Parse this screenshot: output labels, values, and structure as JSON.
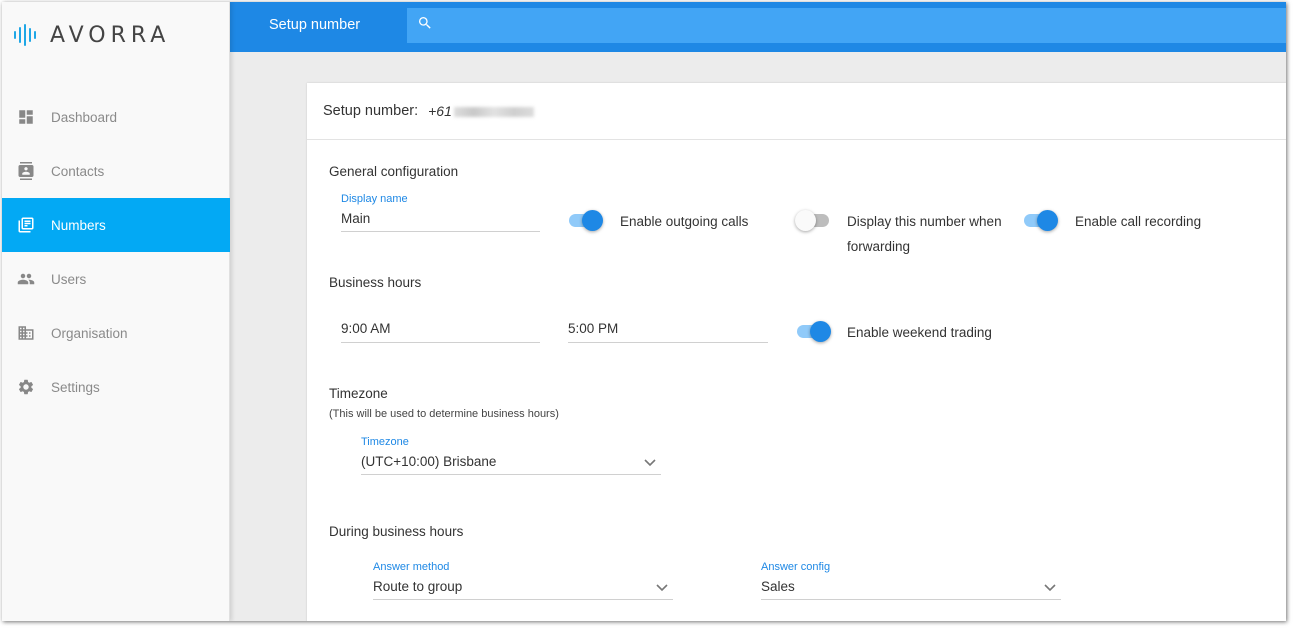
{
  "app": {
    "name": "AVORRA"
  },
  "sidebar": {
    "items": [
      {
        "label": "Dashboard",
        "icon": "dashboard-icon"
      },
      {
        "label": "Contacts",
        "icon": "contacts-icon"
      },
      {
        "label": "Numbers",
        "icon": "numbers-icon",
        "active": true
      },
      {
        "label": "Users",
        "icon": "users-icon"
      },
      {
        "label": "Organisation",
        "icon": "organisation-icon"
      },
      {
        "label": "Settings",
        "icon": "settings-icon"
      }
    ]
  },
  "topbar": {
    "title": "Setup number",
    "search_placeholder": ""
  },
  "card": {
    "title": "Setup number:",
    "number": "+61"
  },
  "general": {
    "heading": "General configuration",
    "display_name_label": "Display name",
    "display_name_value": "Main",
    "outgoing_label": "Enable outgoing calls",
    "outgoing_on": true,
    "forwarding_label": "Display this number when forwarding",
    "forwarding_on": false,
    "recording_label": "Enable call recording",
    "recording_on": true
  },
  "business_hours": {
    "heading": "Business hours",
    "start": "9:00 AM",
    "end": "5:00 PM",
    "weekend_label": "Enable weekend trading",
    "weekend_on": true
  },
  "timezone": {
    "heading": "Timezone",
    "note": "(This will be used to determine business hours)",
    "label": "Timezone",
    "value": "(UTC+10:00) Brisbane"
  },
  "during_hours": {
    "heading": "During business hours",
    "answer_method_label": "Answer method",
    "answer_method_value": "Route to group",
    "answer_config_label": "Answer config",
    "answer_config_value": "Sales"
  },
  "colors": {
    "accent": "#1e88e5",
    "sidebar_active": "#03a9f4",
    "search_bg": "#42a5f5"
  }
}
